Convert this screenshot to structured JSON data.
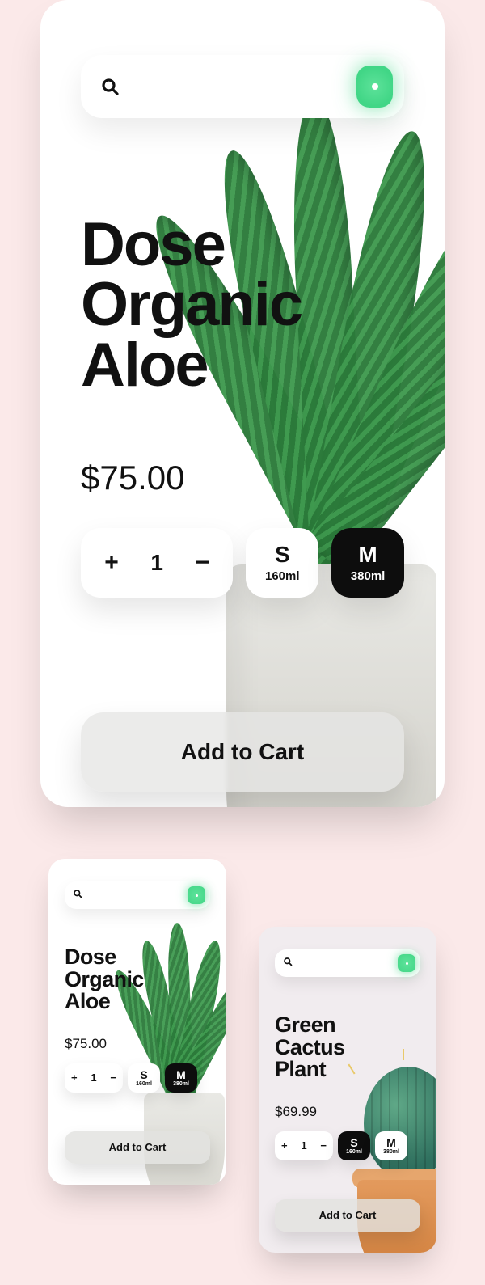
{
  "colors": {
    "accent": "#41d686",
    "ink": "#0d0d0d"
  },
  "search": {
    "placeholder": ""
  },
  "actions": {
    "add_to_cart": "Add to Cart"
  },
  "sizes": [
    {
      "code": "S",
      "volume": "160ml"
    },
    {
      "code": "M",
      "volume": "380ml"
    }
  ],
  "large": {
    "title_l1": "Dose",
    "title_l2": "Organic",
    "title_l3": "Aloe",
    "price": "$75.00",
    "quantity": "1",
    "selected_size_index": 1
  },
  "thumbs": [
    {
      "title_l1": "Dose",
      "title_l2": "Organic",
      "title_l3": "Aloe",
      "price": "$75.00",
      "quantity": "1",
      "selected_size_index": 1
    },
    {
      "title_l1": "Green",
      "title_l2": "Cactus",
      "title_l3": "Plant",
      "price": "$69.99",
      "quantity": "1",
      "selected_size_index": 0
    }
  ]
}
